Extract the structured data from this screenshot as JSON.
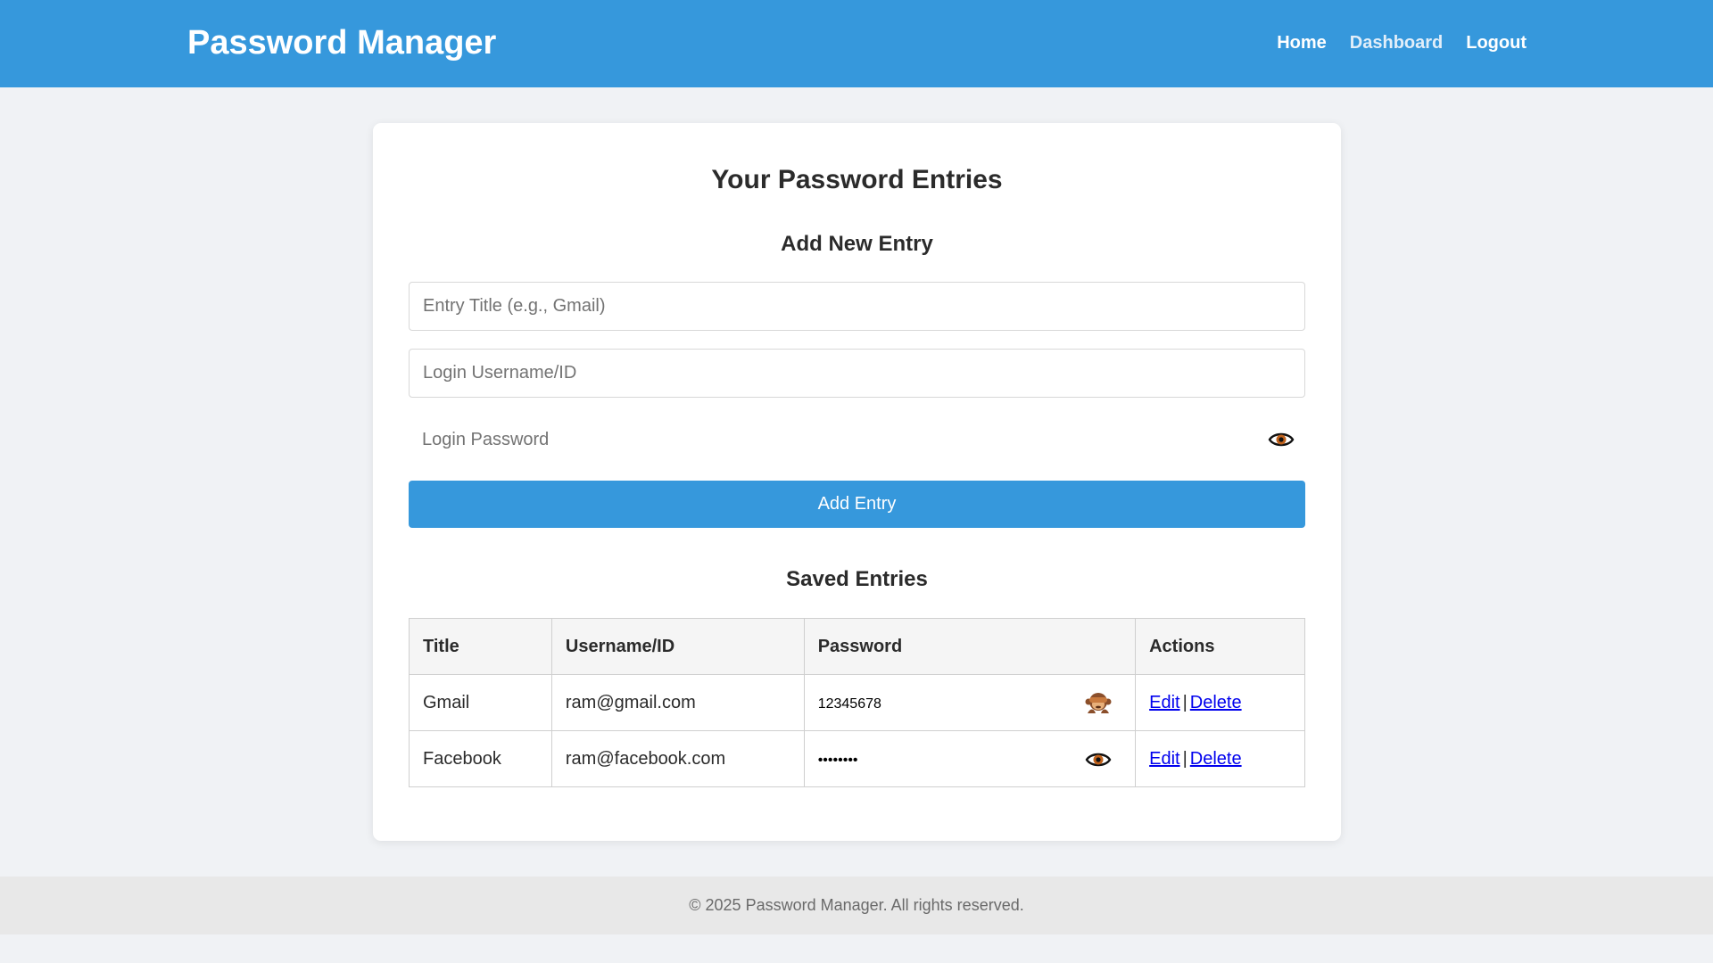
{
  "header": {
    "brand": "Password Manager",
    "nav": {
      "home": "Home",
      "dashboard": "Dashboard",
      "logout": "Logout"
    },
    "background_color": "#3698dc"
  },
  "main": {
    "title": "Your Password Entries",
    "add_section": {
      "title": "Add New Entry",
      "entry_title_placeholder": "Entry Title (e.g., Gmail)",
      "entry_title_value": "",
      "username_placeholder": "Login Username/ID",
      "username_value": "",
      "password_placeholder": "Login Password",
      "password_value": "",
      "password_toggle_icon": "eye-icon",
      "submit_label": "Add Entry"
    },
    "saved_section": {
      "title": "Saved Entries",
      "columns": [
        "Title",
        "Username/ID",
        "Password",
        "Actions"
      ],
      "rows": [
        {
          "title": "Gmail",
          "username": "ram@gmail.com",
          "password": "12345678",
          "toggle_icon": "see-no-evil-monkey-icon",
          "edit": "Edit",
          "separator": "|",
          "delete": "Delete"
        },
        {
          "title": "Facebook",
          "username": "ram@facebook.com",
          "password": "••••••••",
          "toggle_icon": "eye-icon",
          "edit": "Edit",
          "separator": "|",
          "delete": "Delete"
        }
      ]
    }
  },
  "footer": {
    "text": "© 2025 Password Manager. All rights reserved."
  },
  "colors": {
    "accent": "#3698dc",
    "page_background": "#f0f2f5",
    "link": "#0000ee"
  }
}
